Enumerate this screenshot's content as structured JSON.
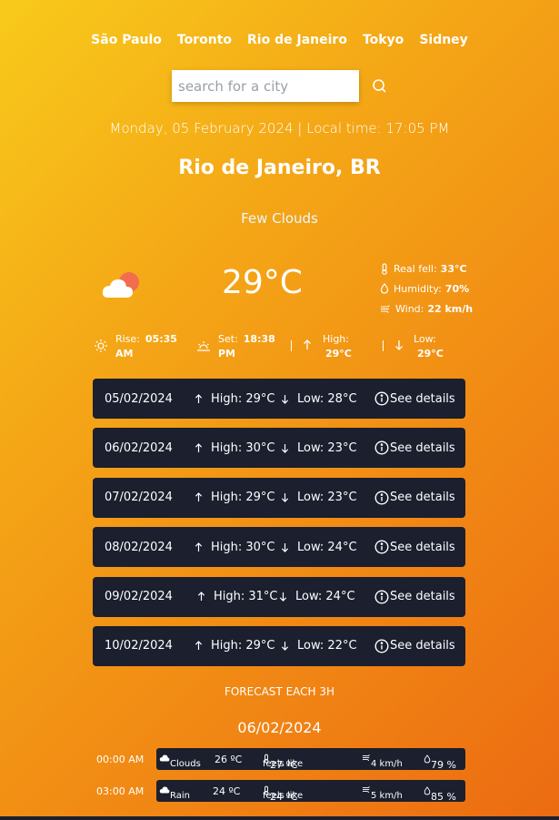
{
  "cities": [
    "São Paulo",
    "Toronto",
    "Rio de Janeiro",
    "Tokyo",
    "Sidney"
  ],
  "search": {
    "placeholder": "search for a city"
  },
  "date_line": "Monday, 05 February 2024 | Local time: 17:05 PM",
  "city_title": "Rio de Janeiro, BR",
  "condition": "Few Clouds",
  "temperature": "29°C",
  "details": {
    "real_feel_label": "Real fell:",
    "real_feel": "33°C",
    "humidity_label": "Humidity:",
    "humidity": "70%",
    "wind_label": "Wind:",
    "wind": "22 km/h"
  },
  "sun": {
    "rise_label": "Rise:",
    "rise_time": "05:35",
    "rise_ampm": "AM",
    "set_label": "Set:",
    "set_time": "18:38",
    "set_ampm": "PM",
    "high_label": "High:",
    "high": "29°C",
    "low_label": "Low:",
    "low": "29°C"
  },
  "days": [
    {
      "date": "05/02/2024",
      "high": "High: 29°C",
      "low": "Low: 28°C",
      "details": "See details"
    },
    {
      "date": "06/02/2024",
      "high": "High: 30°C",
      "low": "Low: 23°C",
      "details": "See details"
    },
    {
      "date": "07/02/2024",
      "high": "High: 29°C",
      "low": "Low: 23°C",
      "details": "See details"
    },
    {
      "date": "08/02/2024",
      "high": "High: 30°C",
      "low": "Low: 24°C",
      "details": "See details"
    },
    {
      "date": "09/02/2024",
      "high": "High: 31°C",
      "low": "Low: 24°C",
      "details": "See details"
    },
    {
      "date": "10/02/2024",
      "high": "High: 29°C",
      "low": "Low: 22°C",
      "details": "See details"
    }
  ],
  "forecast_title": "FORECAST EACH 3H",
  "forecast_date": "06/02/2024",
  "forecast": [
    {
      "time": "00:00 AM",
      "desc": "Clouds",
      "temp": "26 ºC",
      "feels_label": "feels like",
      "feels": "27 ºC",
      "wind": "4 km/h",
      "humidity": "79 %"
    },
    {
      "time": "03:00 AM",
      "desc": "Rain",
      "temp": "24 ºC",
      "feels_label": "feels like",
      "feels": "24 ºC",
      "wind": "5 km/h",
      "humidity": "85 %"
    }
  ],
  "colors": {
    "card": "#1b1f2e",
    "sun_orange": "#f26d4f"
  },
  "icons": {
    "weather": "cloud-sun-icon",
    "search": "search-icon",
    "thermometer": "thermometer-icon",
    "drop": "drop-icon",
    "wind": "wind-icon",
    "sunrise": "sunrise-icon",
    "sunset": "sunset-icon",
    "up": "arrow-up-icon",
    "down": "arrow-down-icon",
    "info": "info-circle-icon",
    "cloud": "cloud-icon"
  }
}
